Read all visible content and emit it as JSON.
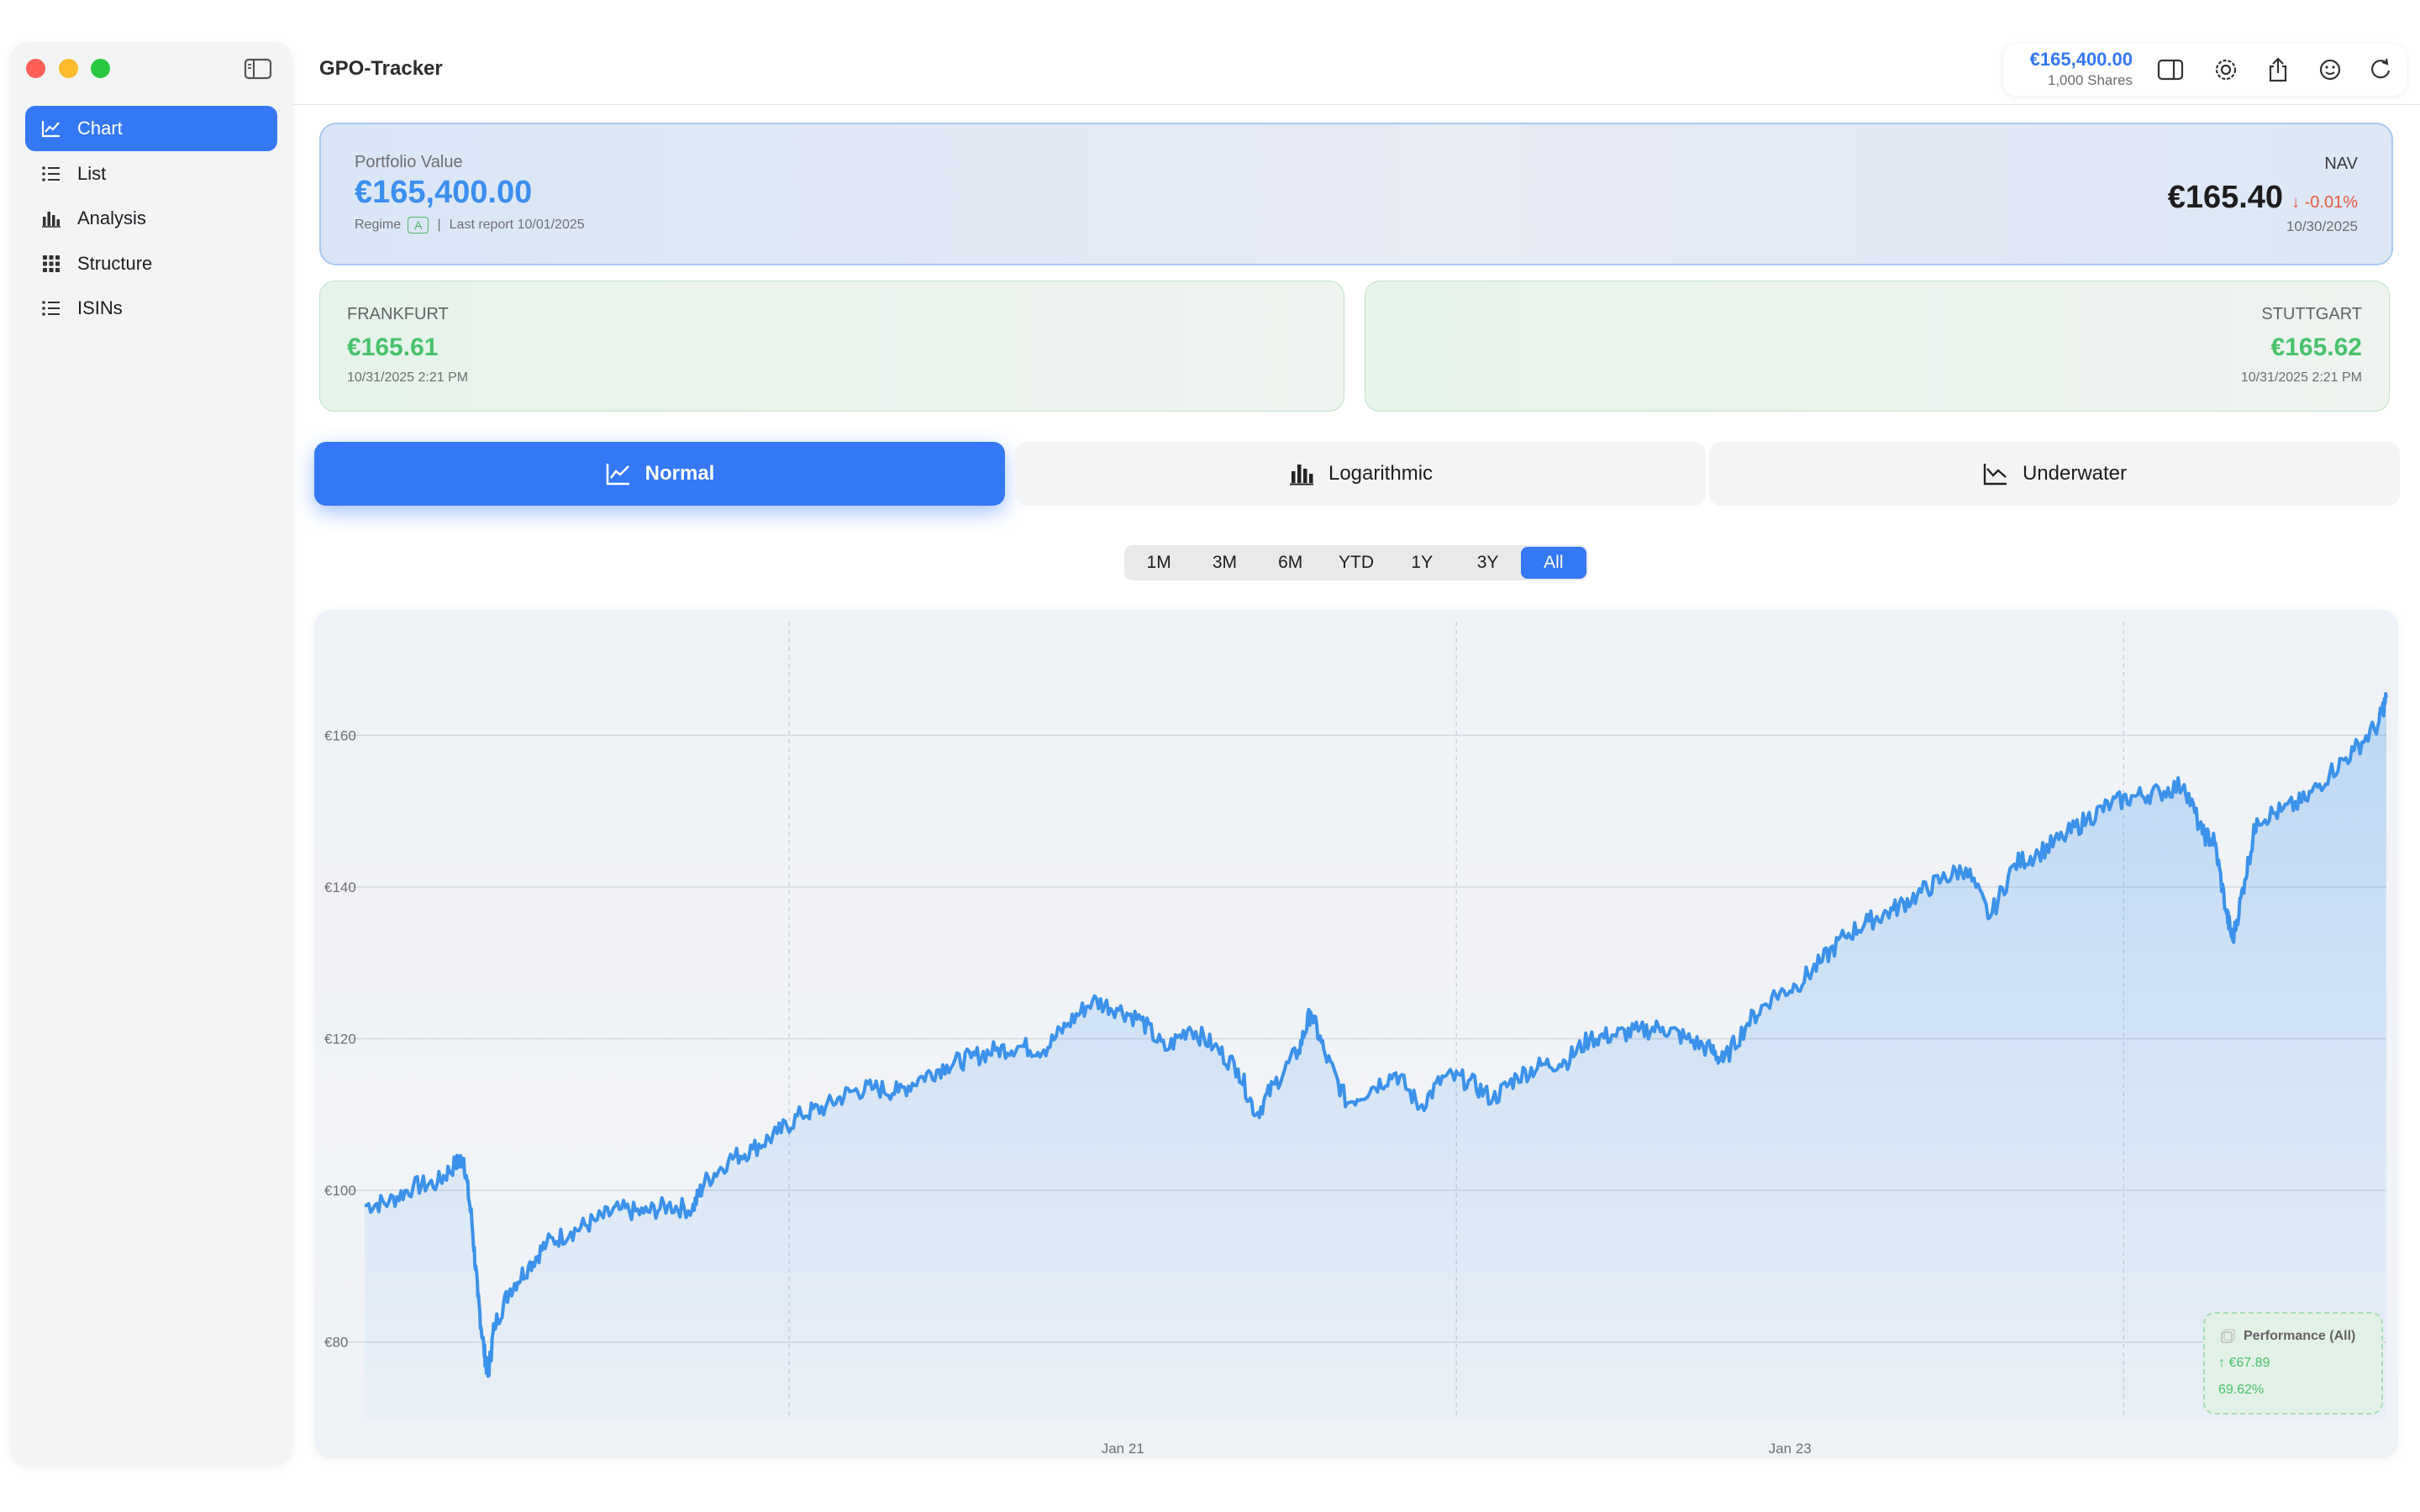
{
  "app": {
    "title": "GPO-Tracker"
  },
  "sidebar": {
    "items": [
      {
        "label": "Chart",
        "icon": "line-chart-icon",
        "active": true
      },
      {
        "label": "List",
        "icon": "list-icon",
        "active": false
      },
      {
        "label": "Analysis",
        "icon": "bar-chart-icon",
        "active": false
      },
      {
        "label": "Structure",
        "icon": "grid-icon",
        "active": false
      },
      {
        "label": "ISINs",
        "icon": "list-icon",
        "active": false
      }
    ]
  },
  "toolbar": {
    "value": "€165,400.00",
    "shares": "1,000 Shares",
    "icons": [
      "sidebar-right-icon",
      "settings-icon",
      "share-icon",
      "smiley-icon",
      "refresh-icon"
    ]
  },
  "portfolio": {
    "label": "Portfolio Value",
    "value": "€165,400.00",
    "regime_label": "Regime",
    "regime": "A",
    "separator": "|",
    "last_report": "Last report 10/01/2025",
    "nav_label": "NAV",
    "nav_price": "€165.40",
    "nav_change": "↓ -0.01%",
    "nav_date": "10/30/2025"
  },
  "exchanges": [
    {
      "name": "FRANKFURT",
      "price": "€165.61",
      "time": "10/31/2025 2:21 PM"
    },
    {
      "name": "STUTTGART",
      "price": "€165.62",
      "time": "10/31/2025 2:21 PM"
    }
  ],
  "modes": [
    {
      "label": "Normal",
      "active": true
    },
    {
      "label": "Logarithmic",
      "active": false
    },
    {
      "label": "Underwater",
      "active": false
    }
  ],
  "ranges": [
    "1M",
    "3M",
    "6M",
    "YTD",
    "1Y",
    "3Y",
    "All"
  ],
  "active_range": "All",
  "performance": {
    "title": "Performance (All)",
    "abs": "↑ €67.89",
    "pct": "69.62%"
  },
  "colors": {
    "accent": "#3478f6",
    "line": "#3b92ea",
    "positive": "#47c26a",
    "negative": "#e8563f"
  },
  "chart_data": {
    "type": "area",
    "y_ticks": [
      "€80",
      "€100",
      "€120",
      "€140",
      "€160"
    ],
    "x_ticks": [
      "Jan 21",
      "Jan 23"
    ],
    "ylim": [
      70,
      175
    ],
    "grid": true,
    "x_range": [
      0,
      100
    ],
    "series": [
      {
        "values": [
          [
            0,
            98
          ],
          [
            1.2,
            98.5
          ],
          [
            2.4,
            100.5
          ],
          [
            3.6,
            101
          ],
          [
            4.5,
            103.5
          ],
          [
            4.9,
            104.2
          ],
          [
            5.3,
            96
          ],
          [
            5.6,
            86
          ],
          [
            5.9,
            79
          ],
          [
            6.1,
            75.5
          ],
          [
            6.4,
            82
          ],
          [
            7.2,
            87
          ],
          [
            8.1,
            90
          ],
          [
            9.0,
            93
          ],
          [
            10.2,
            94.5
          ],
          [
            11.4,
            96
          ],
          [
            12.6,
            97.5
          ],
          [
            13.8,
            97
          ],
          [
            15.0,
            98
          ],
          [
            16.2,
            97.5
          ],
          [
            16.8,
            101
          ],
          [
            18.0,
            104
          ],
          [
            19.2,
            105.5
          ],
          [
            20.4,
            107.5
          ],
          [
            21.6,
            110
          ],
          [
            22.8,
            111
          ],
          [
            24.0,
            113
          ],
          [
            25.2,
            113.5
          ],
          [
            26.4,
            113
          ],
          [
            27.6,
            115
          ],
          [
            28.8,
            116.5
          ],
          [
            30.0,
            117.5
          ],
          [
            31.2,
            118.5
          ],
          [
            32.4,
            119
          ],
          [
            33.6,
            118.5
          ],
          [
            34.8,
            122
          ],
          [
            36.0,
            125
          ],
          [
            37.2,
            124
          ],
          [
            38.4,
            122.5
          ],
          [
            39.6,
            118.5
          ],
          [
            40.8,
            121.5
          ],
          [
            42.0,
            119
          ],
          [
            43.2,
            116
          ],
          [
            44.1,
            110
          ],
          [
            45.0,
            114
          ],
          [
            46.2,
            118.5
          ],
          [
            46.8,
            123.5
          ],
          [
            47.5,
            118
          ],
          [
            48.6,
            111.5
          ],
          [
            49.8,
            113.5
          ],
          [
            51.0,
            115.5
          ],
          [
            52.2,
            111
          ],
          [
            53.4,
            115
          ],
          [
            54.6,
            114.5
          ],
          [
            55.8,
            112
          ],
          [
            57.0,
            115
          ],
          [
            58.2,
            116.5
          ],
          [
            59.4,
            117
          ],
          [
            60.6,
            120
          ],
          [
            61.8,
            120.5
          ],
          [
            63.0,
            121
          ],
          [
            64.2,
            121.5
          ],
          [
            65.4,
            120
          ],
          [
            66.6,
            118.5
          ],
          [
            67.2,
            117
          ],
          [
            68.4,
            122
          ],
          [
            69.6,
            125.5
          ],
          [
            70.8,
            127
          ],
          [
            72.0,
            130
          ],
          [
            73.2,
            133.5
          ],
          [
            74.4,
            135.5
          ],
          [
            75.6,
            137
          ],
          [
            76.8,
            139
          ],
          [
            78.0,
            141
          ],
          [
            79.2,
            142.5
          ],
          [
            80.4,
            136
          ],
          [
            81.6,
            143
          ],
          [
            82.8,
            144.5
          ],
          [
            84.0,
            146.5
          ],
          [
            85.2,
            149
          ],
          [
            86.4,
            151
          ],
          [
            87.6,
            152
          ],
          [
            88.8,
            152.5
          ],
          [
            90.0,
            153.5
          ],
          [
            90.9,
            147
          ],
          [
            91.5,
            146
          ],
          [
            92.1,
            136.5
          ],
          [
            92.4,
            133
          ],
          [
            93.0,
            141
          ],
          [
            93.6,
            149
          ],
          [
            94.8,
            150
          ],
          [
            96.0,
            151.5
          ],
          [
            97.2,
            155
          ],
          [
            98.4,
            158
          ],
          [
            99.6,
            161.5
          ],
          [
            100,
            165
          ]
        ]
      }
    ]
  }
}
